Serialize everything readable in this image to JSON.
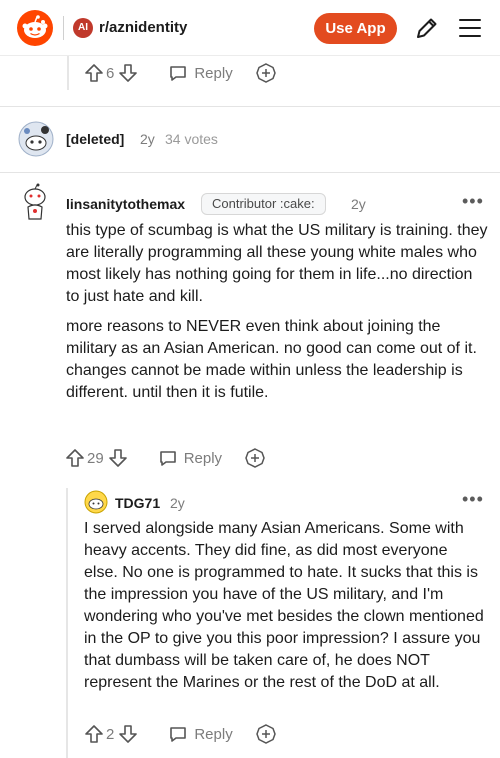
{
  "header": {
    "subreddit_badge": "AI",
    "subreddit": "r/aznidentity",
    "use_app_label": "Use App"
  },
  "prev_comment": {
    "score": "6",
    "reply_label": "Reply"
  },
  "deleted_comment": {
    "username": "[deleted]",
    "age": "2y",
    "votes": "34 votes"
  },
  "comment1": {
    "username": "linsanitytothemax",
    "flair": "Contributor :cake:",
    "age": "2y",
    "paragraph1": "this type of scumbag is what the US military is training. they are literally programming all these young white males who most likely has nothing going for them in life...no direction to just hate and kill.",
    "paragraph2": "more reasons to NEVER even think about joining the military as an Asian American. no good can come out of it. changes cannot be made within unless the leadership is different. until then it is futile.",
    "score": "29",
    "reply_label": "Reply"
  },
  "comment2": {
    "username": "TDG71",
    "age": "2y",
    "body": "I served alongside many Asian Americans. Some with heavy accents. They did fine, as did most everyone else. No one is programmed to hate. It sucks that this is the impression you have of the US military, and I'm wondering who you've met besides the clown mentioned in the OP to give you this poor impression? I assure you that dumbass will be taken care of, he does NOT represent the Marines or the rest of the DoD at all.",
    "score": "2",
    "reply_label": "Reply"
  },
  "colors": {
    "brand": "#ff4500",
    "use_app_bg": "#e34b1f",
    "subreddit_badge": "#c0392b",
    "muted_text": "#7c7c7c"
  }
}
